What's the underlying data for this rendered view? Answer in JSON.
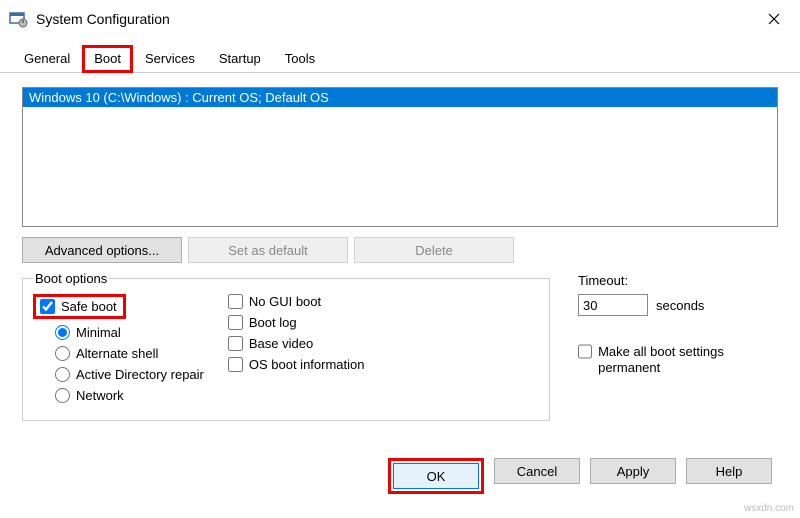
{
  "window": {
    "title": "System Configuration"
  },
  "tabs": {
    "general": "General",
    "boot": "Boot",
    "services": "Services",
    "startup": "Startup",
    "tools": "Tools"
  },
  "os_entry": "Windows 10 (C:\\Windows) : Current OS; Default OS",
  "buttons": {
    "advanced": "Advanced options...",
    "set_default": "Set as default",
    "delete": "Delete",
    "ok": "OK",
    "cancel": "Cancel",
    "apply": "Apply",
    "help": "Help"
  },
  "boot_options": {
    "legend": "Boot options",
    "safe_boot": "Safe boot",
    "minimal": "Minimal",
    "alt_shell": "Alternate shell",
    "ad_repair": "Active Directory repair",
    "network": "Network",
    "no_gui": "No GUI boot",
    "boot_log": "Boot log",
    "base_video": "Base video",
    "os_info": "OS boot information"
  },
  "timeout": {
    "label": "Timeout:",
    "value": "30",
    "unit": "seconds"
  },
  "permanent": "Make all boot settings permanent",
  "watermark": "wsxdn.com"
}
